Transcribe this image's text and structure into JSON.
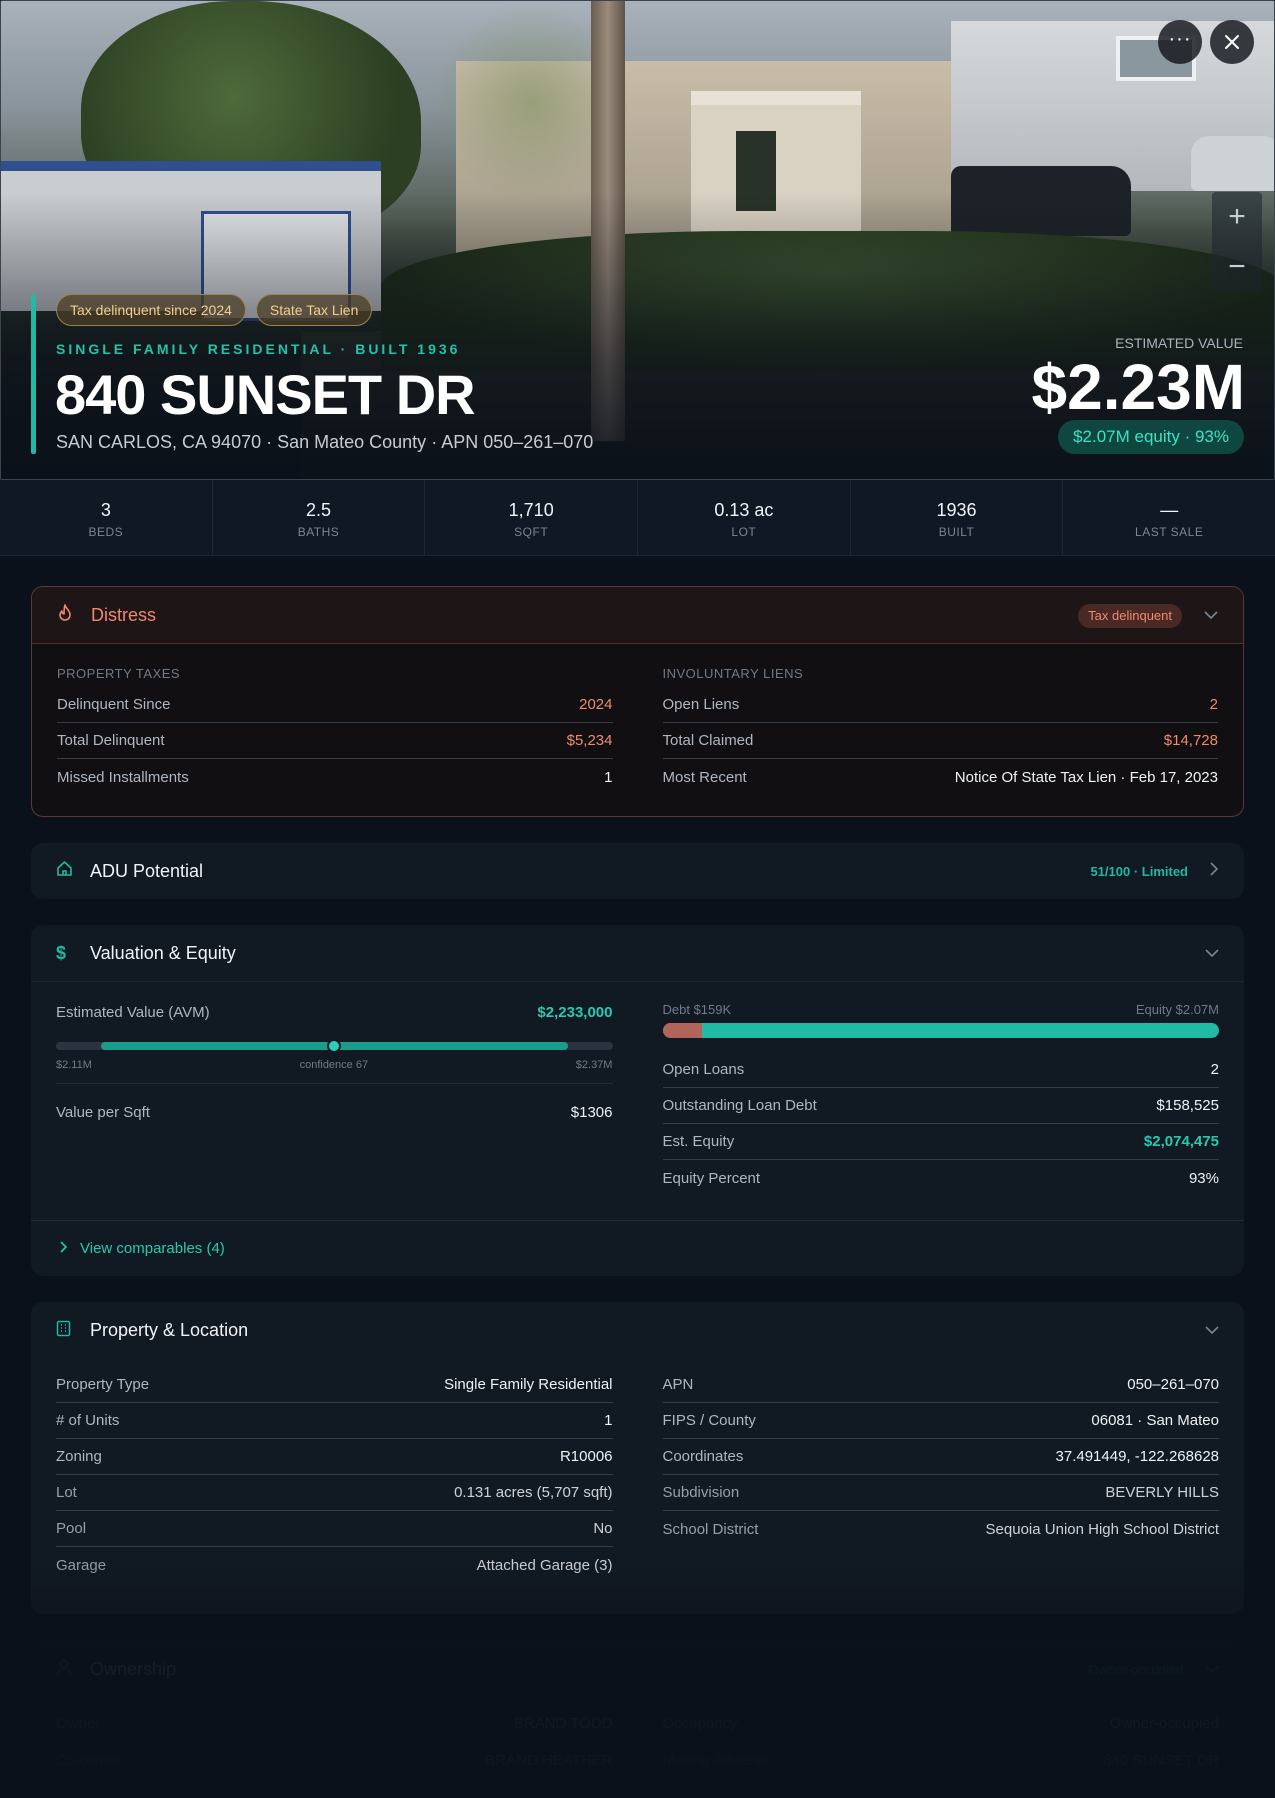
{
  "hero": {
    "badges": [
      "Tax delinquent since 2024",
      "State Tax Lien"
    ],
    "eyebrow": "SINGLE FAMILY RESIDENTIAL · BUILT 1936",
    "title": "840 SUNSET DR",
    "subtitle": "SAN CARLOS, CA 94070 · San Mateo County · APN 050–261–070",
    "est_label": "ESTIMATED VALUE",
    "est_value": "$2.23M",
    "equity_pill": "$2.07M equity · 93%",
    "zoom_in": "+",
    "zoom_out": "−"
  },
  "stats": [
    {
      "value": "3",
      "label": "BEDS"
    },
    {
      "value": "2.5",
      "label": "BATHS"
    },
    {
      "value": "1,710",
      "label": "SQFT"
    },
    {
      "value": "0.13 ac",
      "label": "LOT"
    },
    {
      "value": "1936",
      "label": "BUILT"
    },
    {
      "value": "—",
      "label": "LAST SALE"
    }
  ],
  "distress": {
    "title": "Distress",
    "badge": "Tax delinquent",
    "left_label": "PROPERTY TAXES",
    "left_rows": [
      {
        "k": "Delinquent Since",
        "v": "2024"
      },
      {
        "k": "Total Delinquent",
        "v": "$5,234"
      },
      {
        "k": "Missed Installments",
        "v": "1"
      }
    ],
    "right_label": "INVOLUNTARY LIENS",
    "right_rows": [
      {
        "k": "Open Liens",
        "v": "2"
      },
      {
        "k": "Total Claimed",
        "v": "$14,728"
      },
      {
        "k": "Most Recent",
        "v": "Notice Of State Tax Lien · Feb 17, 2023"
      }
    ]
  },
  "adu": {
    "title": "ADU Potential",
    "score": "51/100 · Limited"
  },
  "valuation": {
    "title": "Valuation & Equity",
    "avm_label": "Estimated Value (AVM)",
    "avm_value": "$2,233,000",
    "range_low": "$2.11M",
    "confidence": "confidence 67",
    "range_high": "$2.37M",
    "range_fill_start": 0.08,
    "range_fill_end": 0.92,
    "estimate_position": 0.5,
    "ppsf_label": "Value per Sqft",
    "ppsf_value": "$1306",
    "debt_label": "Debt $159K",
    "equity_label": "Equity $2.07M",
    "debt_fraction": 0.071,
    "rows": [
      {
        "k": "Open Loans",
        "v": "2"
      },
      {
        "k": "Outstanding Loan Debt",
        "v": "$158,525"
      },
      {
        "k": "Est. Equity",
        "v": "$2,074,475"
      },
      {
        "k": "Equity Percent",
        "v": "93%"
      }
    ],
    "comps": "View comparables (4)"
  },
  "property": {
    "title": "Property & Location",
    "left_rows": [
      {
        "k": "Property Type",
        "v": "Single Family Residential"
      },
      {
        "k": "# of Units",
        "v": "1"
      },
      {
        "k": "Zoning",
        "v": "R10006"
      },
      {
        "k": "Lot",
        "v": "0.131 acres (5,707 sqft)"
      },
      {
        "k": "Pool",
        "v": "No"
      },
      {
        "k": "Garage",
        "v": "Attached Garage (3)"
      }
    ],
    "right_rows": [
      {
        "k": "APN",
        "v": "050–261–070"
      },
      {
        "k": "FIPS / County",
        "v": "06081 · San Mateo"
      },
      {
        "k": "Coordinates",
        "v": "37.491449, -122.268628"
      },
      {
        "k": "Subdivision",
        "v": "BEVERLY HILLS"
      },
      {
        "k": "School District",
        "v": "Sequoia Union High School District"
      }
    ]
  },
  "ownership": {
    "title": "Ownership",
    "badge": "Owner-occupied",
    "left_rows": [
      {
        "k": "Owner",
        "v": "BRAND TODD"
      },
      {
        "k": "Co-owner",
        "v": "BRAND HEATHER"
      }
    ],
    "right_rows": [
      {
        "k": "Occupancy",
        "v": "Owner-occupied"
      },
      {
        "k": "Mailing Address",
        "v": "840 SUNSET DR"
      }
    ]
  },
  "colors": {
    "accent": "#22b8a4",
    "danger": "#f08a6e",
    "warning": "#f0cf91"
  }
}
